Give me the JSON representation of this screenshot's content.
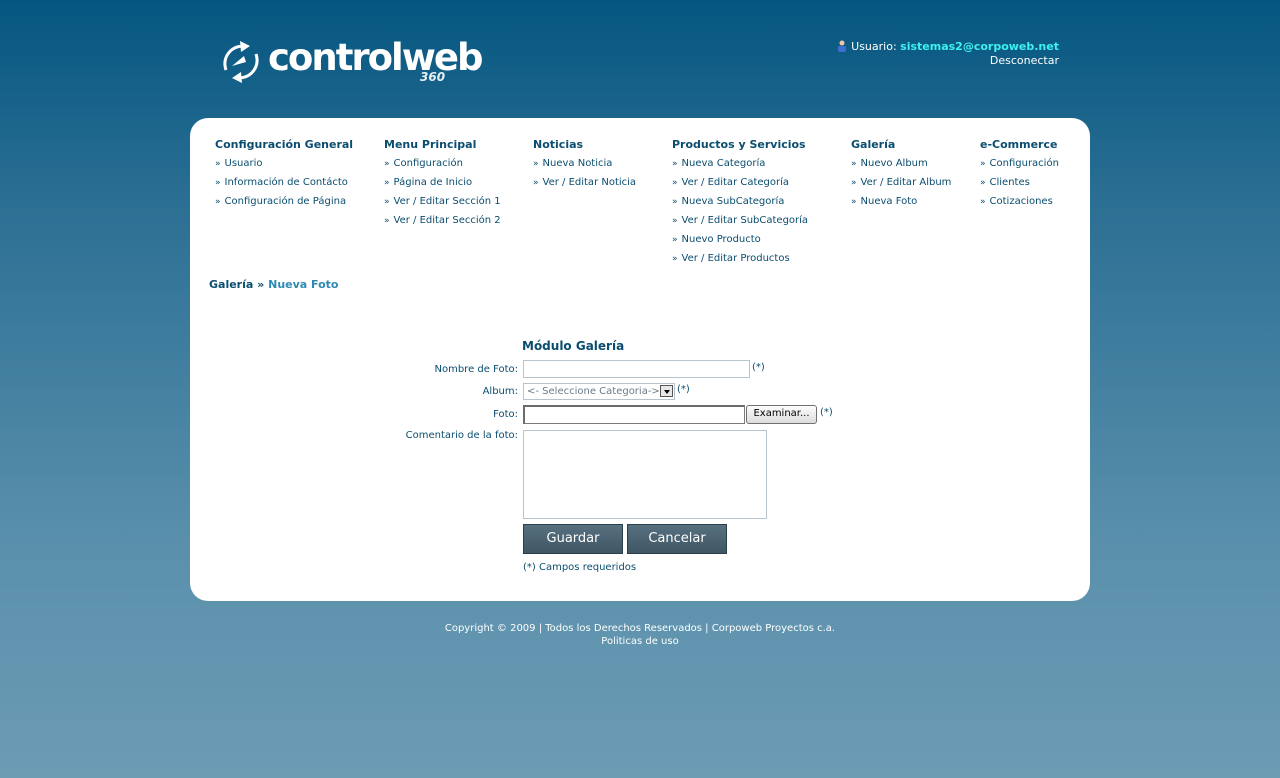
{
  "header": {
    "logo_text": "controlweb",
    "logo_sub": "360",
    "user_label": "Usuario:",
    "user_email": "sistemas2@corpoweb.net",
    "logout": "Desconectar"
  },
  "menu": [
    {
      "title": "Configuración General",
      "items": [
        "Usuario",
        "Información de Contácto",
        "Configuración de Página"
      ]
    },
    {
      "title": "Menu Principal",
      "items": [
        "Configuración",
        "Página de Inicio",
        "Ver / Editar Sección 1",
        "Ver / Editar Sección 2"
      ]
    },
    {
      "title": "Noticias",
      "items": [
        "Nueva Noticia",
        "Ver / Editar Noticia"
      ]
    },
    {
      "title": "Productos y Servicios",
      "items": [
        "Nueva Categoría",
        "Ver / Editar Categoría",
        "Nueva SubCategoría",
        "Ver / Editar SubCategoría",
        "Nuevo Producto",
        "Ver / Editar Productos"
      ]
    },
    {
      "title": "Galería",
      "items": [
        "Nuevo Album",
        "Ver / Editar Album",
        "Nueva Foto"
      ]
    },
    {
      "title": "e-Commerce",
      "items": [
        "Configuración",
        "Clientes",
        "Cotizaciones"
      ]
    }
  ],
  "breadcrumb": {
    "parent": "Galería",
    "separator": "»",
    "current": "Nueva Foto"
  },
  "form": {
    "title": "Módulo Galería",
    "name_label": "Nombre de Foto:",
    "name_value": "",
    "album_label": "Album:",
    "album_selected": "<- Seleccione Categoria->",
    "photo_label": "Foto:",
    "browse_label": "Examinar...",
    "comment_label": "Comentario de la foto:",
    "required_mark": "(*)",
    "save_label": "Guardar",
    "cancel_label": "Cancelar",
    "required_note": "(*) Campos requeridos"
  },
  "footer": {
    "copyright": "Copyright © 2009 | Todos los Derechos Reservados | Corpoweb Proyectos c.a.",
    "policies": "Politicas de uso"
  }
}
